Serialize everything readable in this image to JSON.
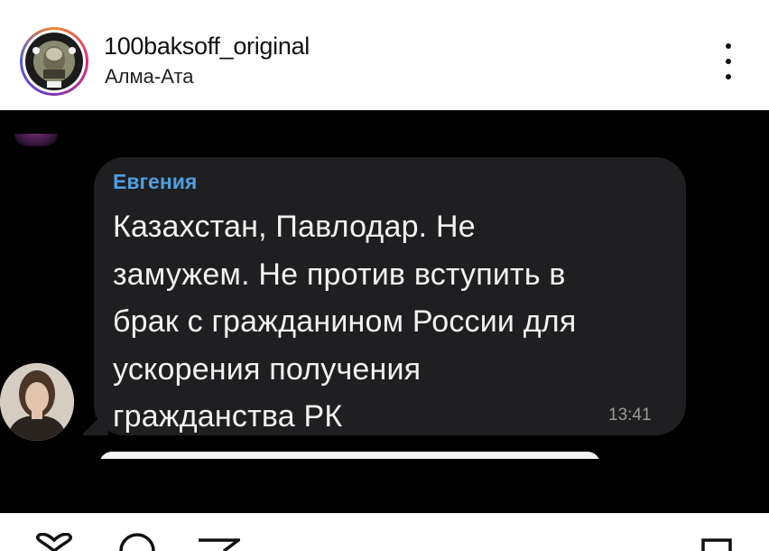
{
  "post": {
    "username": "100baksoff_original",
    "location": "Алма-Ата",
    "more_icon": "more-vertical-icon"
  },
  "chat": {
    "sender_name": "Евгения",
    "message": "Казахстан, Павлодар. Не\nзамужем. Не против вступить в\nбрак с гражданином России для\nускорения получения\nгражданства РК",
    "time": "13:41",
    "colors": {
      "sender_name": "#4f9fe0",
      "bubble": "#1f1f21",
      "background": "#000000"
    }
  },
  "actions": {
    "icons": [
      "heart-icon",
      "comment-icon",
      "share-icon",
      "bookmark-icon"
    ]
  }
}
